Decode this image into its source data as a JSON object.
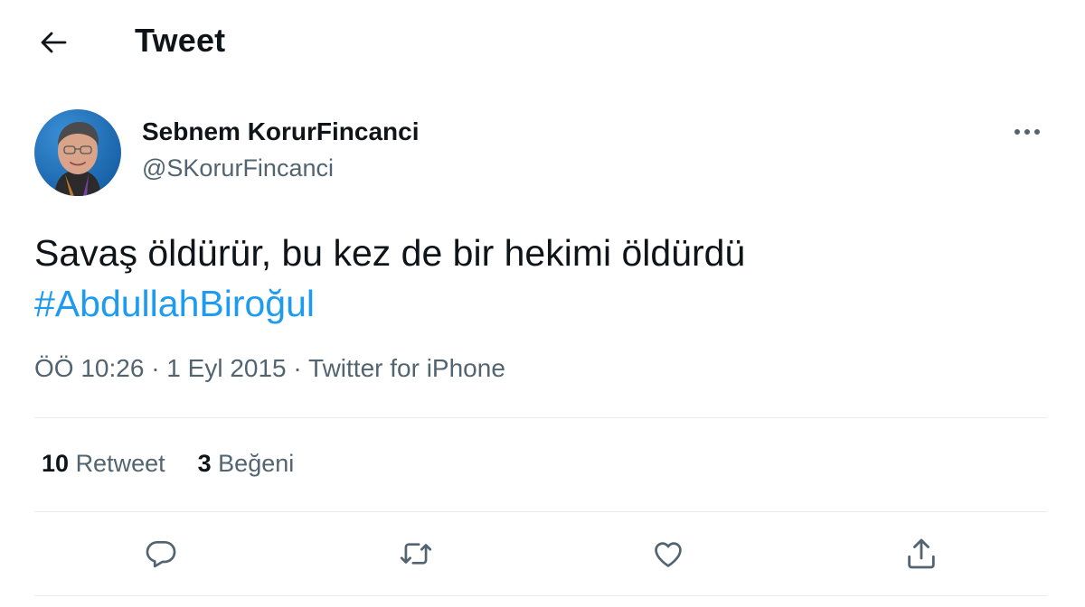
{
  "header": {
    "title": "Tweet",
    "back_icon": "arrow-left-icon"
  },
  "author": {
    "name": "Sebnem KorurFincanci",
    "handle": "@SKorurFincanci"
  },
  "tweet": {
    "text": "Savaş öldürür, bu kez de bir hekimi öldürdü",
    "hashtag": "#AbdullahBiroğul",
    "time": "ÖÖ 10:26",
    "separator": "·",
    "date": "1 Eyl 2015",
    "source": "Twitter for iPhone"
  },
  "stats": {
    "retweets_count": "10",
    "retweets_label": "Retweet",
    "likes_count": "3",
    "likes_label": "Beğeni"
  },
  "actions": [
    "reply-icon",
    "retweet-icon",
    "like-icon",
    "share-icon"
  ],
  "colors": {
    "hashtag": "#1d9bf0",
    "secondary_text": "#536471",
    "divider": "#e6ecf0"
  }
}
